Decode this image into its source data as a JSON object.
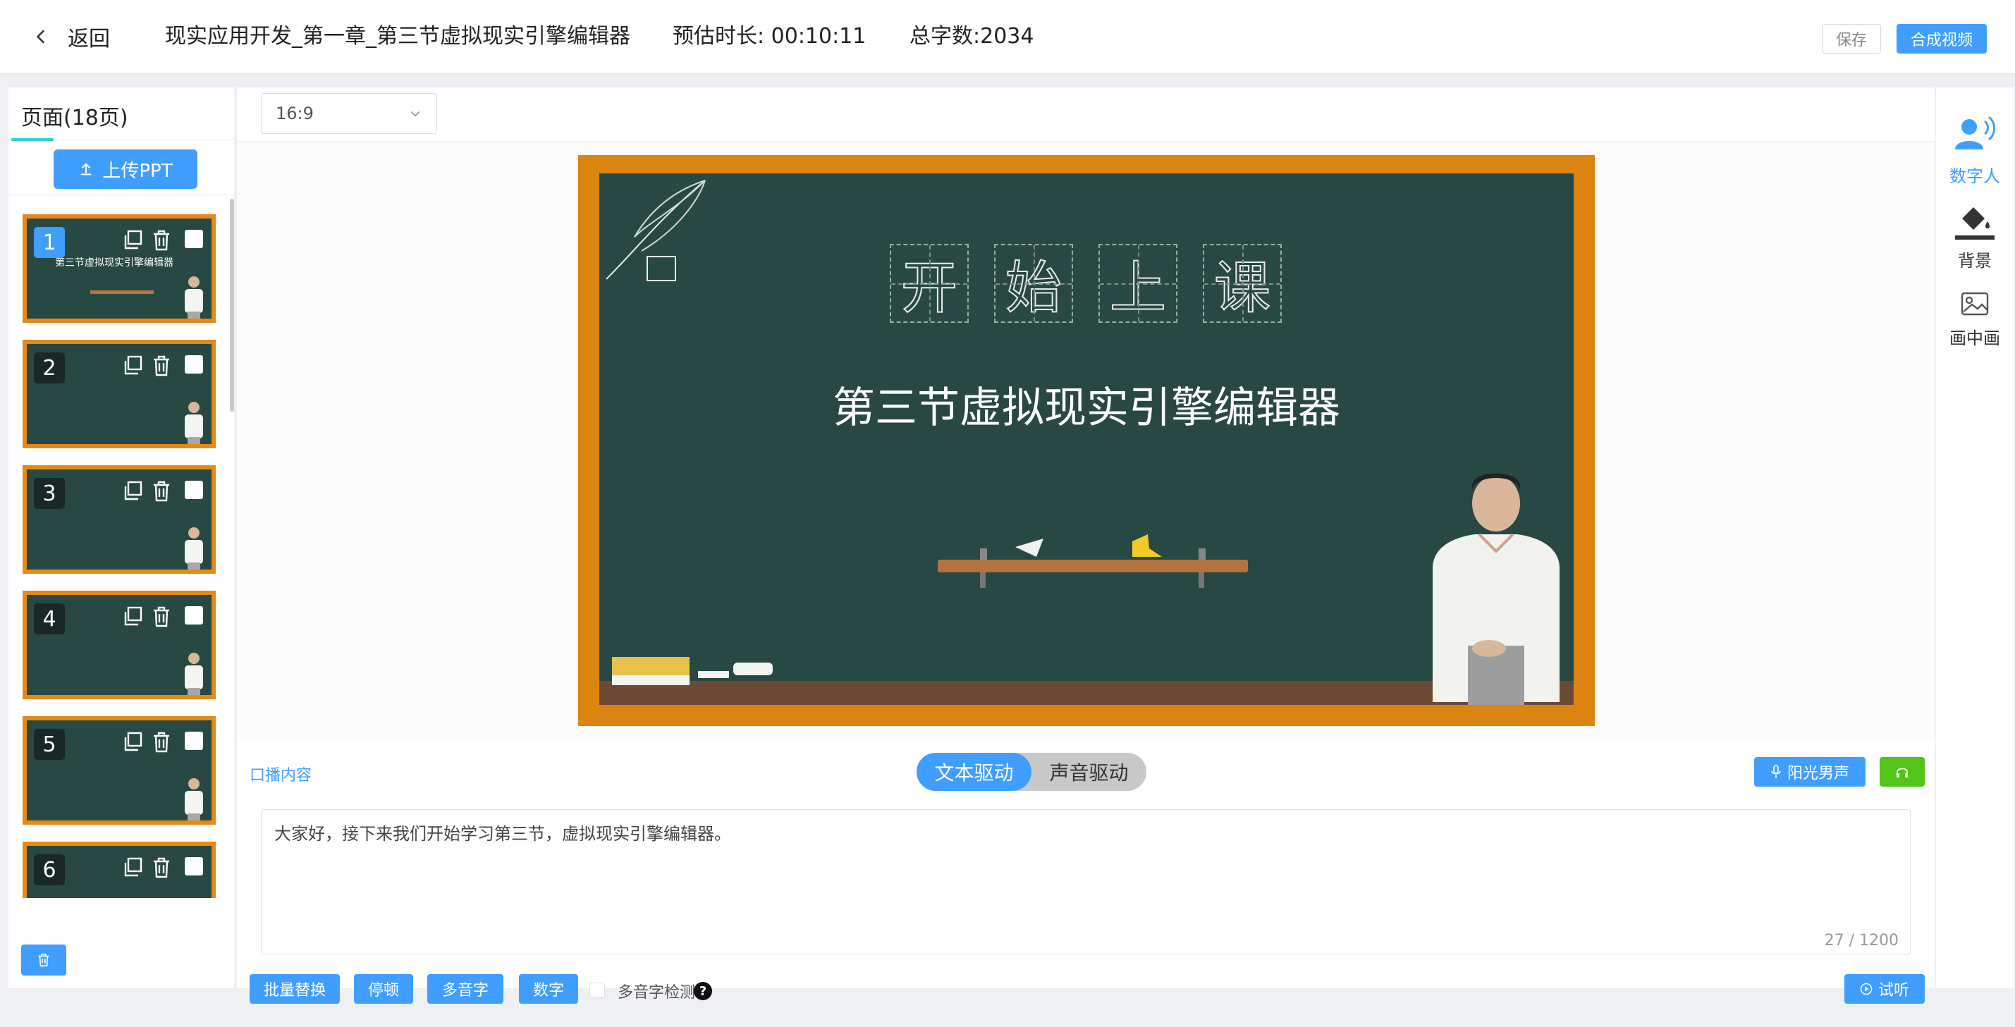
{
  "header": {
    "back_label": "返回",
    "course_title": "现实应用开发_第一章_第三节虚拟现实引擎编辑器",
    "duration": "预估时长: 00:10:11",
    "word_count": "总字数:2034",
    "save_label": "保存",
    "compose_label": "合成视频"
  },
  "sidebar": {
    "tab_label": "页面(18页)",
    "upload_label": "上传PPT",
    "pages": [
      {
        "number": "1",
        "title": "第三节虚拟现实引擎编辑器"
      },
      {
        "number": "2"
      },
      {
        "number": "3"
      },
      {
        "number": "4"
      },
      {
        "number": "5"
      },
      {
        "number": "6"
      }
    ]
  },
  "toolbar": {
    "ratio": "16:9"
  },
  "slide": {
    "heading_chars": [
      "开",
      "始",
      "上",
      "课"
    ],
    "subtitle": "第三节虚拟现实引擎编辑器"
  },
  "script": {
    "label": "口播内容",
    "text_drive": "文本驱动",
    "audio_drive": "声音驱动",
    "voice": "阳光男声",
    "content": "大家好，接下来我们开始学习第三节，虚拟现实引擎编辑器。",
    "counter": "27 / 1200"
  },
  "bottom": {
    "batch_replace": "批量替换",
    "pause": "停顿",
    "polyphone": "多音字",
    "number": "数字",
    "polyphone_check": "多音字检测",
    "help": "?",
    "trial": "试听"
  },
  "right_panel": {
    "digital_human": "数字人",
    "background": "背景",
    "pip": "画中画"
  },
  "colors": {
    "accent": "#409eff",
    "green": "#52c41a",
    "chalkboard": "#284843",
    "frame": "#dc8412"
  }
}
